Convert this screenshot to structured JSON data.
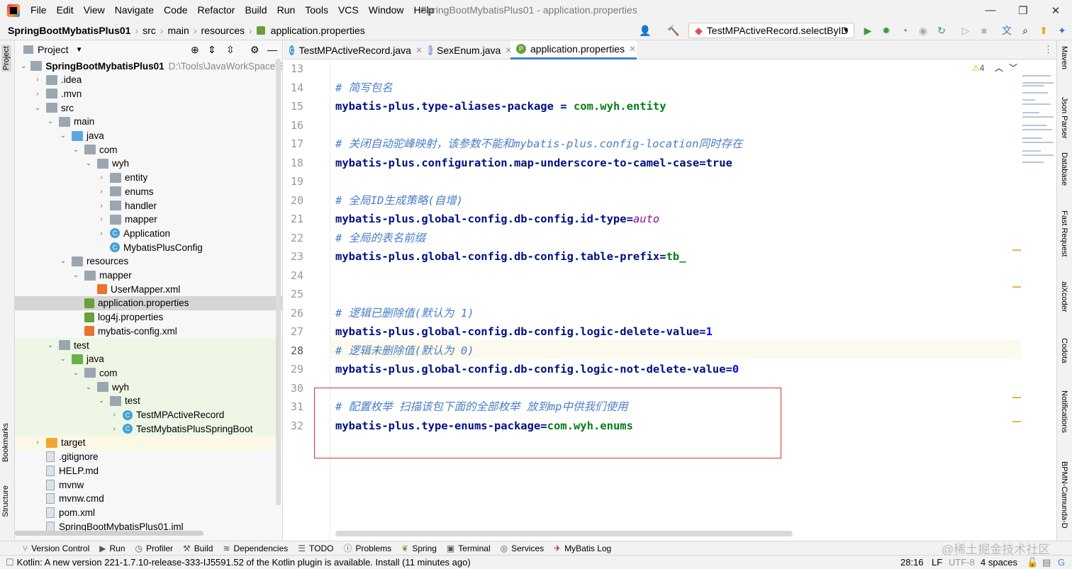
{
  "menubar": {
    "items": [
      "File",
      "Edit",
      "View",
      "Navigate",
      "Code",
      "Refactor",
      "Build",
      "Run",
      "Tools",
      "VCS",
      "Window",
      "Help"
    ],
    "title": "SpringBootMybatisPlus01 - application.properties"
  },
  "navbar": {
    "breadcrumbs": [
      "SpringBootMybatisPlus01",
      "src",
      "main",
      "resources",
      "application.properties"
    ],
    "run_config": "TestMPActiveRecord.selectByID"
  },
  "left_strip": {
    "project": "Project",
    "bookmarks": "Bookmarks",
    "structure": "Structure"
  },
  "right_strip": [
    "Maven",
    "Json Parser",
    "Database",
    "Fast Request",
    "aiXcoder",
    "Codota",
    "Notifications",
    "BPMN-Camunda-D"
  ],
  "project_panel": {
    "title": "Project",
    "tree": [
      {
        "label": "SpringBootMybatisPlus01",
        "extra": "D:\\Tools\\JavaWorkSpace\\Sprin",
        "depth": 0,
        "arrow": "v",
        "icon": "folder"
      },
      {
        "label": ".idea",
        "depth": 1,
        "arrow": ">",
        "icon": "folder"
      },
      {
        "label": ".mvn",
        "depth": 1,
        "arrow": ">",
        "icon": "folder"
      },
      {
        "label": "src",
        "depth": 1,
        "arrow": "v",
        "icon": "folder"
      },
      {
        "label": "main",
        "depth": 2,
        "arrow": "v",
        "icon": "folder"
      },
      {
        "label": "java",
        "depth": 3,
        "arrow": "v",
        "icon": "folder-blue"
      },
      {
        "label": "com",
        "depth": 4,
        "arrow": "v",
        "icon": "folder"
      },
      {
        "label": "wyh",
        "depth": 5,
        "arrow": "v",
        "icon": "folder"
      },
      {
        "label": "entity",
        "depth": 6,
        "arrow": ">",
        "icon": "folder"
      },
      {
        "label": "enums",
        "depth": 6,
        "arrow": ">",
        "icon": "folder"
      },
      {
        "label": "handler",
        "depth": 6,
        "arrow": ">",
        "icon": "folder"
      },
      {
        "label": "mapper",
        "depth": 6,
        "arrow": ">",
        "icon": "folder"
      },
      {
        "label": "Application",
        "depth": 6,
        "arrow": ">",
        "icon": "class"
      },
      {
        "label": "MybatisPlusConfig",
        "depth": 6,
        "arrow": "",
        "icon": "class"
      },
      {
        "label": "resources",
        "depth": 3,
        "arrow": "v",
        "icon": "folder"
      },
      {
        "label": "mapper",
        "depth": 4,
        "arrow": "v",
        "icon": "folder"
      },
      {
        "label": "UserMapper.xml",
        "depth": 5,
        "arrow": "",
        "icon": "xml"
      },
      {
        "label": "application.properties",
        "depth": 4,
        "arrow": "",
        "icon": "prop",
        "selected": true
      },
      {
        "label": "log4j.properties",
        "depth": 4,
        "arrow": "",
        "icon": "prop"
      },
      {
        "label": "mybatis-config.xml",
        "depth": 4,
        "arrow": "",
        "icon": "xml"
      },
      {
        "label": "test",
        "depth": 2,
        "arrow": "v",
        "icon": "folder",
        "green": true
      },
      {
        "label": "java",
        "depth": 3,
        "arrow": "v",
        "icon": "folder-green",
        "green": true
      },
      {
        "label": "com",
        "depth": 4,
        "arrow": "v",
        "icon": "folder",
        "green": true
      },
      {
        "label": "wyh",
        "depth": 5,
        "arrow": "v",
        "icon": "folder",
        "green": true
      },
      {
        "label": "test",
        "depth": 6,
        "arrow": "v",
        "icon": "folder",
        "green": true
      },
      {
        "label": "TestMPActiveRecord",
        "depth": 7,
        "arrow": ">",
        "icon": "class",
        "green": true
      },
      {
        "label": "TestMybatisPlusSpringBoot",
        "depth": 7,
        "arrow": ">",
        "icon": "class",
        "green": true
      },
      {
        "label": "target",
        "depth": 1,
        "arrow": ">",
        "icon": "folder-orange",
        "yellow": true
      },
      {
        "label": ".gitignore",
        "depth": 1,
        "arrow": "",
        "icon": "file"
      },
      {
        "label": "HELP.md",
        "depth": 1,
        "arrow": "",
        "icon": "file"
      },
      {
        "label": "mvnw",
        "depth": 1,
        "arrow": "",
        "icon": "file"
      },
      {
        "label": "mvnw.cmd",
        "depth": 1,
        "arrow": "",
        "icon": "file"
      },
      {
        "label": "pom.xml",
        "depth": 1,
        "arrow": "",
        "icon": "file"
      },
      {
        "label": "SpringBootMybatisPlus01.iml",
        "depth": 1,
        "arrow": "",
        "icon": "file"
      }
    ]
  },
  "tabs": [
    {
      "label": "TestMPActiveRecord.java",
      "icon": "C",
      "color": "#45a1ce"
    },
    {
      "label": "SexEnum.java",
      "icon": "E",
      "color": "#8c9bdc"
    },
    {
      "label": "application.properties",
      "icon": "P",
      "color": "#6a9f3a",
      "active": true
    }
  ],
  "editor": {
    "warnings": "4",
    "lines": [
      {
        "n": "13",
        "parts": []
      },
      {
        "n": "14",
        "parts": [
          {
            "t": "# 简写包名",
            "c": "cm"
          }
        ]
      },
      {
        "n": "15",
        "parts": [
          {
            "t": "mybatis-plus.type-aliases-package",
            "c": "key"
          },
          {
            "t": " = ",
            "c": "key"
          },
          {
            "t": "com.wyh.entity",
            "c": "val"
          }
        ]
      },
      {
        "n": "16",
        "parts": []
      },
      {
        "n": "17",
        "parts": [
          {
            "t": "# 关闭自动驼峰映射，该参数不能和mybatis-plus.config-location同时存在",
            "c": "cm"
          }
        ]
      },
      {
        "n": "18",
        "parts": [
          {
            "t": "mybatis-plus.configuration.map-underscore-to-camel-case=",
            "c": "key"
          },
          {
            "t": "true",
            "c": "key"
          }
        ]
      },
      {
        "n": "19",
        "parts": []
      },
      {
        "n": "20",
        "parts": [
          {
            "t": "# 全局ID生成策略(自增)",
            "c": "cm"
          }
        ]
      },
      {
        "n": "21",
        "parts": [
          {
            "t": "mybatis-plus.global-config.db-config.id-type=",
            "c": "key"
          },
          {
            "t": "auto",
            "c": "enumv"
          }
        ]
      },
      {
        "n": "22",
        "parts": [
          {
            "t": "# 全局的表名前缀",
            "c": "cm"
          }
        ]
      },
      {
        "n": "23",
        "parts": [
          {
            "t": "mybatis-plus.global-config.db-config.table-prefix=",
            "c": "key"
          },
          {
            "t": "tb_",
            "c": "val"
          }
        ]
      },
      {
        "n": "24",
        "parts": []
      },
      {
        "n": "25",
        "parts": []
      },
      {
        "n": "26",
        "parts": [
          {
            "t": "# 逻辑已删除值(默认为 1)",
            "c": "cm"
          }
        ]
      },
      {
        "n": "27",
        "parts": [
          {
            "t": "mybatis-plus.global-config.db-config.logic-delete-value=",
            "c": "key"
          },
          {
            "t": "1",
            "c": "num"
          }
        ]
      },
      {
        "n": "28",
        "parts": [
          {
            "t": "# 逻辑未删除值(默认为 0)",
            "c": "cm"
          }
        ]
      },
      {
        "n": "29",
        "parts": [
          {
            "t": "mybatis-plus.global-config.db-config.logic-not-delete-value=",
            "c": "key"
          },
          {
            "t": "0",
            "c": "num"
          }
        ]
      },
      {
        "n": "30",
        "parts": []
      },
      {
        "n": "31",
        "parts": [
          {
            "t": "# 配置枚举 扫描该包下面的全部枚举 放到mp中供我们使用",
            "c": "cm"
          }
        ]
      },
      {
        "n": "32",
        "parts": [
          {
            "t": "mybatis-plus.type-enums-package=",
            "c": "key"
          },
          {
            "t": "com.wyh.enums",
            "c": "val"
          }
        ]
      }
    ]
  },
  "bottom_tools": [
    "Version Control",
    "Run",
    "Profiler",
    "Build",
    "Dependencies",
    "TODO",
    "Problems",
    "Spring",
    "Terminal",
    "Services",
    "MyBatis Log"
  ],
  "status": {
    "message": "Kotlin: A new version 221-1.7.10-release-333-IJ5591.52 of the Kotlin plugin is available. Install (11 minutes ago)",
    "position": "28:16",
    "line_sep": "LF",
    "encoding": "UTF-8",
    "indent": "4 spaces"
  },
  "watermark": "@稀土掘金技术社区"
}
